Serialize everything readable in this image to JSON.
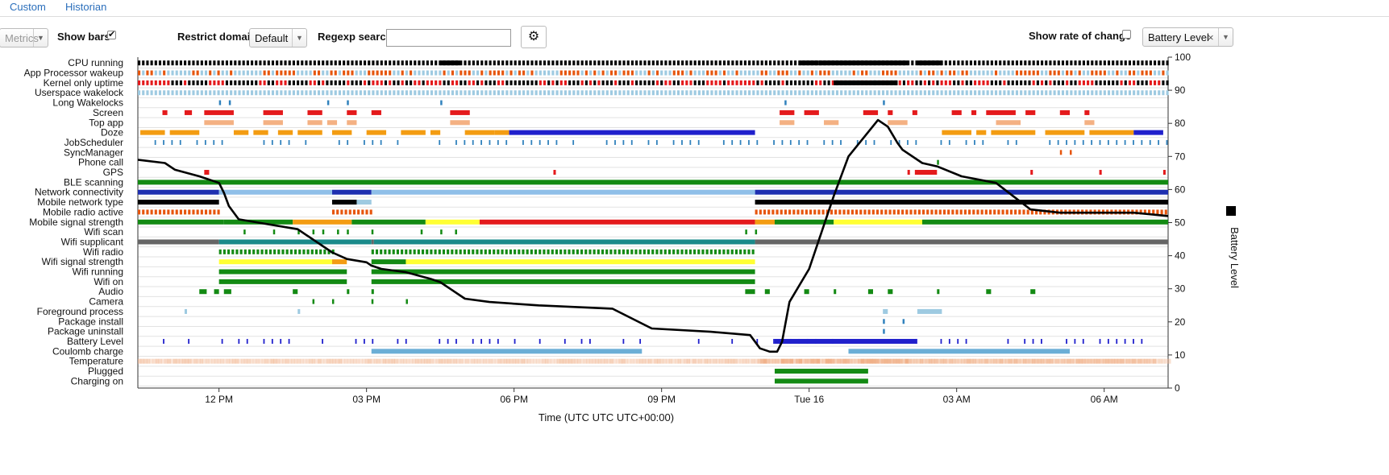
{
  "tabs": [
    {
      "label": "Custom"
    },
    {
      "label": "Historian"
    }
  ],
  "controls": {
    "metrics_value": "Metrics",
    "show_bars_label": "Show bars",
    "show_bars_checked": "✔",
    "restrict_domain_label": "Restrict domain",
    "restrict_domain_value": "Default",
    "regexp_label": "Regexp search",
    "regexp_value": "",
    "show_rate_label": "Show rate of change",
    "metric_select_value": "Battery Level",
    "clear_glyph": "×",
    "dropdown_glyph": "▼"
  },
  "colors": {
    "black": "#000000",
    "light_blue": "#9ecae1",
    "orange_red": "#e6550d",
    "red": "#e41a1c",
    "mid_blue": "#3182bd",
    "dark_blue": "#2020cc",
    "orange": "#f39c12",
    "green": "#138a13",
    "navy": "#1e2fb0",
    "sky": "#8fbfe8",
    "gray": "#666666",
    "teal": "#1a8a8a",
    "yellow": "#ffff33",
    "purple": "#7a6fb4",
    "peach": "#fdae6b",
    "salmon": "#f4b183",
    "coulomb": "#6baed6",
    "temp": "#f0b088"
  },
  "chart_data": {
    "type": "timeline",
    "xlabel": "Time (UTC UTC UTC+00:00)",
    "ylabel": "Battery Level",
    "ylim": [
      0,
      100
    ],
    "yticks": [
      0,
      10,
      20,
      30,
      40,
      50,
      60,
      70,
      80,
      90,
      100
    ],
    "x_range_hours": [
      10.35,
      31.3
    ],
    "x_ticks": [
      {
        "label": "12 PM",
        "hour": 12
      },
      {
        "label": "03 PM",
        "hour": 15
      },
      {
        "label": "06 PM",
        "hour": 18
      },
      {
        "label": "09 PM",
        "hour": 21
      },
      {
        "label": "Tue 16",
        "hour": 24
      },
      {
        "label": "03 AM",
        "hour": 27
      },
      {
        "label": "06 AM",
        "hour": 30
      }
    ],
    "rows": [
      {
        "name": "CPU running",
        "pattern": "dense",
        "color": "black",
        "spans": [
          [
            10.35,
            31.3
          ]
        ],
        "solid": [
          [
            16.5,
            16.9
          ],
          [
            23.8,
            24.2
          ],
          [
            24.2,
            26.0
          ],
          [
            26.2,
            26.7
          ]
        ]
      },
      {
        "name": "App Processor wakeup",
        "pattern": "mixed",
        "color": "light_blue",
        "alt": "orange_red",
        "spans": [
          [
            10.35,
            31.3
          ]
        ]
      },
      {
        "name": "Kernel only uptime",
        "pattern": "mixed",
        "color": "black",
        "alt": "red",
        "spans": [
          [
            10.35,
            31.3
          ]
        ],
        "solid": [
          [
            24.5,
            25.8
          ]
        ]
      },
      {
        "name": "Userspace wakelock",
        "pattern": "dense",
        "color": "light_blue",
        "spans": [
          [
            10.35,
            31.3
          ]
        ]
      },
      {
        "name": "Long Wakelocks",
        "pattern": "ticks",
        "color": "mid_blue",
        "ticks": [
          12.0,
          12.2,
          14.2,
          14.6,
          16.5,
          23.5,
          25.5
        ]
      },
      {
        "name": "Screen",
        "pattern": "blocks",
        "color": "red",
        "spans": [
          [
            10.85,
            10.95
          ],
          [
            11.3,
            11.45
          ],
          [
            11.7,
            12.3
          ],
          [
            12.9,
            13.3
          ],
          [
            13.8,
            14.1
          ],
          [
            14.6,
            14.8
          ],
          [
            15.1,
            15.3
          ],
          [
            16.7,
            17.1
          ],
          [
            23.4,
            23.7
          ],
          [
            23.9,
            24.2
          ],
          [
            25.1,
            25.4
          ],
          [
            25.6,
            25.7
          ],
          [
            26.1,
            26.2
          ],
          [
            26.9,
            27.1
          ],
          [
            27.3,
            27.4
          ],
          [
            27.6,
            28.2
          ],
          [
            28.4,
            28.6
          ],
          [
            29.1,
            29.3
          ],
          [
            29.6,
            29.7
          ]
        ]
      },
      {
        "name": "Top app",
        "pattern": "blocks",
        "color": "salmon",
        "spans": [
          [
            11.7,
            12.3
          ],
          [
            12.9,
            13.3
          ],
          [
            13.8,
            14.1
          ],
          [
            14.2,
            14.4
          ],
          [
            14.6,
            14.8
          ],
          [
            16.7,
            17.1
          ],
          [
            23.4,
            23.7
          ],
          [
            24.3,
            24.6
          ],
          [
            25.6,
            26.0
          ],
          [
            27.8,
            28.3
          ],
          [
            29.6,
            29.8
          ]
        ]
      },
      {
        "name": "Doze",
        "pattern": "blocks",
        "color": "orange",
        "spans": [
          [
            10.4,
            10.9
          ],
          [
            11.0,
            11.6
          ],
          [
            12.3,
            12.6
          ],
          [
            12.7,
            13.0
          ],
          [
            13.2,
            13.5
          ],
          [
            13.6,
            14.1
          ],
          [
            14.3,
            14.7
          ],
          [
            15.0,
            15.4
          ],
          [
            15.7,
            16.2
          ],
          [
            16.3,
            16.5
          ],
          [
            17.0,
            17.6
          ],
          [
            17.6,
            17.9
          ],
          [
            26.7,
            27.3
          ],
          [
            27.4,
            27.6
          ],
          [
            27.7,
            28.6
          ],
          [
            28.8,
            29.6
          ],
          [
            29.7,
            30.6
          ]
        ],
        "solid_alt": [
          [
            17.9,
            22.9
          ],
          [
            30.6,
            31.2
          ]
        ],
        "alt": "dark_blue"
      },
      {
        "name": "JobScheduler",
        "pattern": "ticks_dense",
        "color": "mid_blue",
        "spans": [
          [
            10.35,
            31.3
          ]
        ]
      },
      {
        "name": "SyncManager",
        "pattern": "ticks",
        "color": "orange_red",
        "ticks": [
          29.1,
          29.3
        ]
      },
      {
        "name": "Phone call",
        "pattern": "ticks",
        "color": "green",
        "ticks": [
          26.6
        ]
      },
      {
        "name": "GPS",
        "pattern": "blocks",
        "color": "red",
        "spans": [
          [
            11.7,
            11.8
          ],
          [
            18.8,
            18.85
          ],
          [
            26.0,
            26.05
          ],
          [
            26.15,
            26.6
          ],
          [
            28.5,
            28.55
          ],
          [
            29.9,
            29.95
          ],
          [
            31.2,
            31.25
          ]
        ]
      },
      {
        "name": "BLE scanning",
        "pattern": "solid",
        "color": "green",
        "spans": [
          [
            10.35,
            31.3
          ]
        ]
      },
      {
        "name": "Network connectivity",
        "pattern": "blocks",
        "color": "navy",
        "spans": [
          [
            10.35,
            12.0
          ],
          [
            14.3,
            15.1
          ],
          [
            22.9,
            31.3
          ]
        ],
        "alt_spans": [
          [
            12.0,
            14.3
          ],
          [
            15.1,
            22.9
          ]
        ],
        "alt": "sky"
      },
      {
        "name": "Mobile network type",
        "pattern": "blocks",
        "color": "black",
        "spans": [
          [
            10.35,
            12.0
          ],
          [
            14.3,
            14.8
          ],
          [
            22.9,
            31.3
          ]
        ],
        "alt_spans": [
          [
            14.8,
            15.1
          ]
        ],
        "alt": "light_blue"
      },
      {
        "name": "Mobile radio active",
        "pattern": "dense",
        "color": "orange_red",
        "spans": [
          [
            10.35,
            12.0
          ],
          [
            14.3,
            15.1
          ],
          [
            22.9,
            31.3
          ]
        ]
      },
      {
        "name": "Mobile signal strength",
        "pattern": "multi",
        "spans": [
          [
            10.35,
            12.1,
            "green"
          ],
          [
            12.1,
            13.5,
            "green"
          ],
          [
            13.5,
            14.7,
            "orange"
          ],
          [
            14.7,
            16.2,
            "green"
          ],
          [
            16.2,
            17.3,
            "yellow"
          ],
          [
            17.3,
            22.9,
            "red"
          ],
          [
            22.9,
            23.3,
            "orange"
          ],
          [
            23.3,
            24.5,
            "green"
          ],
          [
            24.5,
            26.3,
            "yellow"
          ],
          [
            26.3,
            31.3,
            "green"
          ]
        ]
      },
      {
        "name": "Wifi scan",
        "pattern": "ticks",
        "color": "green",
        "ticks": [
          12.5,
          13.1,
          13.6,
          13.9,
          14.1,
          14.4,
          14.6,
          15.1,
          16.1,
          16.5,
          16.8,
          22.7,
          22.9
        ]
      },
      {
        "name": "Wifi supplicant",
        "pattern": "blocks",
        "color": "gray",
        "spans": [
          [
            10.35,
            12.0
          ],
          [
            15.1,
            15.15
          ],
          [
            22.9,
            31.3
          ]
        ],
        "alt_spans": [
          [
            12.0,
            15.1
          ],
          [
            15.15,
            22.9
          ]
        ],
        "alt": "teal"
      },
      {
        "name": "Wifi radio",
        "pattern": "dense",
        "color": "green",
        "spans": [
          [
            12.0,
            14.3
          ],
          [
            15.1,
            22.9
          ]
        ]
      },
      {
        "name": "Wifi signal strength",
        "pattern": "multi",
        "spans": [
          [
            12.0,
            14.3,
            "yellow"
          ],
          [
            14.3,
            14.6,
            "orange"
          ],
          [
            15.1,
            15.8,
            "green"
          ],
          [
            15.8,
            22.9,
            "yellow"
          ]
        ]
      },
      {
        "name": "Wifi running",
        "pattern": "solid",
        "color": "green",
        "spans": [
          [
            12.0,
            14.6
          ],
          [
            15.1,
            22.9
          ]
        ]
      },
      {
        "name": "Wifi on",
        "pattern": "solid",
        "color": "green",
        "spans": [
          [
            12.0,
            14.6
          ],
          [
            15.1,
            22.9
          ]
        ]
      },
      {
        "name": "Audio",
        "pattern": "blocks",
        "color": "green",
        "spans": [
          [
            11.6,
            11.75
          ],
          [
            11.9,
            12.0
          ],
          [
            12.1,
            12.25
          ],
          [
            13.5,
            13.6
          ],
          [
            14.6,
            14.65
          ],
          [
            15.1,
            15.15
          ],
          [
            22.7,
            22.9
          ],
          [
            23.1,
            23.2
          ],
          [
            23.9,
            24.0
          ],
          [
            24.5,
            24.55
          ],
          [
            25.2,
            25.3
          ],
          [
            25.6,
            25.7
          ],
          [
            26.6,
            26.65
          ],
          [
            27.6,
            27.7
          ],
          [
            28.5,
            28.6
          ]
        ]
      },
      {
        "name": "Camera",
        "pattern": "ticks",
        "color": "green",
        "ticks": [
          13.9,
          14.3,
          15.1,
          15.8
        ]
      },
      {
        "name": "Foreground process",
        "pattern": "blocks",
        "color": "light_blue",
        "spans": [
          [
            11.3,
            11.35
          ],
          [
            13.6,
            13.65
          ],
          [
            25.5,
            25.6
          ],
          [
            26.2,
            26.7
          ]
        ]
      },
      {
        "name": "Package install",
        "pattern": "ticks",
        "color": "mid_blue",
        "ticks": [
          25.5,
          25.9
        ]
      },
      {
        "name": "Package uninstall",
        "pattern": "ticks",
        "color": "mid_blue",
        "ticks": [
          25.5
        ]
      },
      {
        "name": "Battery Level",
        "pattern": "ticks_dense_blue",
        "color": "dark_blue",
        "spans": [
          [
            10.35,
            31.3
          ]
        ],
        "solid": [
          [
            23.3,
            26.2
          ]
        ]
      },
      {
        "name": "Coulomb charge",
        "pattern": "solid",
        "color": "coulomb",
        "spans": [
          [
            15.1,
            20.6
          ],
          [
            24.8,
            29.3
          ]
        ]
      },
      {
        "name": "Temperature",
        "pattern": "gradient",
        "color": "temp",
        "spans": [
          [
            10.35,
            31.3
          ]
        ]
      },
      {
        "name": "Plugged",
        "pattern": "solid",
        "color": "green",
        "spans": [
          [
            23.3,
            25.2
          ]
        ]
      },
      {
        "name": "Charging on",
        "pattern": "solid",
        "color": "green",
        "spans": [
          [
            23.3,
            25.2
          ]
        ]
      }
    ],
    "battery_series": {
      "name": "Battery Level",
      "x": [
        10.35,
        10.9,
        11.1,
        11.6,
        12.0,
        12.1,
        12.2,
        12.4,
        12.8,
        13.6,
        14.3,
        14.6,
        15.0,
        15.1,
        15.3,
        15.8,
        16.3,
        16.5,
        16.7,
        17.0,
        17.5,
        18.5,
        20.0,
        20.8,
        22.0,
        22.8,
        23.0,
        23.2,
        23.35,
        23.45,
        23.6,
        24.0,
        24.5,
        24.8,
        25.4,
        25.6,
        25.8,
        25.9,
        26.3,
        26.6,
        27.1,
        27.8,
        28.5,
        29.1,
        29.8,
        30.6,
        31.3
      ],
      "y": [
        69,
        68,
        66,
        64,
        62,
        59,
        55,
        51,
        50,
        48,
        41,
        39,
        38,
        37,
        36,
        35,
        33,
        32,
        30,
        27,
        26,
        25,
        24,
        18,
        17,
        16,
        12,
        11,
        11,
        14,
        26,
        36,
        58,
        70,
        81,
        79,
        74,
        72,
        68,
        67,
        64,
        62,
        54,
        53,
        53,
        53,
        52
      ]
    },
    "legend": {
      "label": "Battery Level",
      "placement": "right"
    }
  }
}
